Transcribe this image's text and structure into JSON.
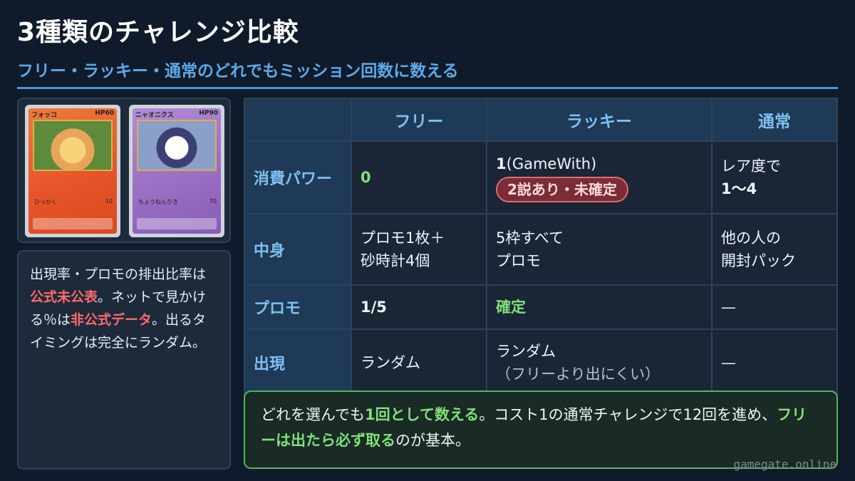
{
  "header": {
    "title": "3種類のチャレンジ比較",
    "subtitle": "フリー・ラッキー・通常のどれでもミッション回数に数える"
  },
  "cards": [
    {
      "name": "フォッコ",
      "hp": "HP60",
      "move": "ひっかく",
      "damage": "10"
    },
    {
      "name": "ニャオニクス",
      "hp": "HP90",
      "move": "ちょうねんりき",
      "damage": "70"
    }
  ],
  "note": {
    "p1": "出現率・プロモの排出比率は",
    "red1": "公式未公表",
    "p2": "。ネットで見かける％は",
    "red2": "非公式データ",
    "p3": "。出るタイミングは完全にランダム。"
  },
  "table": {
    "headers": [
      "フリー",
      "ラッキー",
      "通常"
    ],
    "rows": {
      "cost": {
        "label": "消費パワー",
        "free": "0",
        "lucky_num": "1",
        "lucky_src": "(GameWith)",
        "lucky_badge": "2説あり・未確定",
        "normal_l1": "レア度で",
        "normal_l2": "1〜4"
      },
      "content": {
        "label": "中身",
        "free_l1": "プロモ1枚＋",
        "free_l2": "砂時計4個",
        "lucky_l1": "5枠すべて",
        "lucky_l2": "プロモ",
        "normal_l1": "他の人の",
        "normal_l2": "開封パック"
      },
      "promo": {
        "label": "プロモ",
        "free": "1/5",
        "lucky": "確定",
        "normal": "—"
      },
      "appear": {
        "label": "出現",
        "free": "ランダム",
        "lucky_l1": "ランダム",
        "lucky_l2": "（フリーより出にくい）",
        "normal": "—"
      }
    }
  },
  "summary": {
    "s1": "どれを選んでも",
    "g1": "1回として数える",
    "s2": "。コスト1の通常チャレンジで12回を進め、",
    "g2": "フリーは出たら必ず取る",
    "s3": "のが基本。"
  },
  "watermark": "gamegate.online"
}
